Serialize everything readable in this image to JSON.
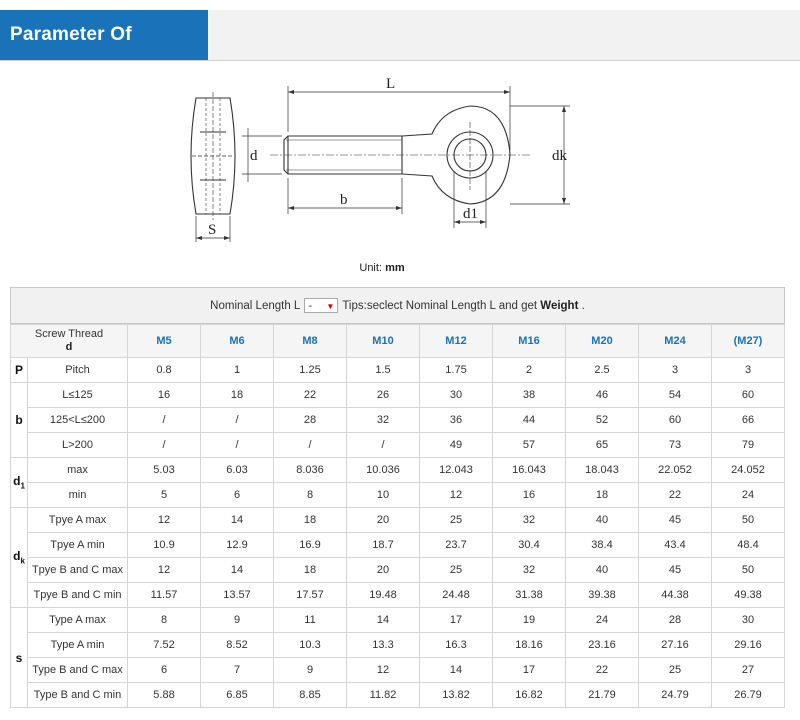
{
  "header": {
    "title": "Parameter Of Product"
  },
  "drawing": {
    "labels": {
      "L": "L",
      "d": "d",
      "dk": "dk",
      "b": "b",
      "d1": "d1",
      "S": "S"
    }
  },
  "unit": {
    "prefix": "Unit:",
    "value": "mm"
  },
  "selector": {
    "prefix": "Nominal Length L",
    "value": "-",
    "tips": "Tips:seclect Nominal Length L and get",
    "tips_bold": "Weight",
    "tips_end": "."
  },
  "table": {
    "header_label": "Screw Thread",
    "header_sub": "d",
    "columns": [
      "M5",
      "M6",
      "M8",
      "M10",
      "M12",
      "M16",
      "M20",
      "M24",
      "(M27)"
    ],
    "groups": [
      {
        "symbol": "P",
        "sub": "",
        "rows": [
          {
            "label": "Pitch",
            "values": [
              "0.8",
              "1",
              "1.25",
              "1.5",
              "1.75",
              "2",
              "2.5",
              "3",
              "3"
            ]
          }
        ]
      },
      {
        "symbol": "b",
        "sub": "",
        "rows": [
          {
            "label": "L≤125",
            "values": [
              "16",
              "18",
              "22",
              "26",
              "30",
              "38",
              "46",
              "54",
              "60"
            ]
          },
          {
            "label": "125<L≤200",
            "values": [
              "/",
              "/",
              "28",
              "32",
              "36",
              "44",
              "52",
              "60",
              "66"
            ]
          },
          {
            "label": "L>200",
            "values": [
              "/",
              "/",
              "/",
              "/",
              "49",
              "57",
              "65",
              "73",
              "79"
            ]
          }
        ]
      },
      {
        "symbol": "d",
        "sub": "1",
        "rows": [
          {
            "label": "max",
            "values": [
              "5.03",
              "6.03",
              "8.036",
              "10.036",
              "12.043",
              "16.043",
              "18.043",
              "22.052",
              "24.052"
            ]
          },
          {
            "label": "min",
            "values": [
              "5",
              "6",
              "8",
              "10",
              "12",
              "16",
              "18",
              "22",
              "24"
            ]
          }
        ]
      },
      {
        "symbol": "d",
        "sub": "k",
        "rows": [
          {
            "label": "Tpye A max",
            "values": [
              "12",
              "14",
              "18",
              "20",
              "25",
              "32",
              "40",
              "45",
              "50"
            ]
          },
          {
            "label": "Tpye A min",
            "values": [
              "10.9",
              "12.9",
              "16.9",
              "18.7",
              "23.7",
              "30.4",
              "38.4",
              "43.4",
              "48.4"
            ]
          },
          {
            "label": "Tpye B and C max",
            "values": [
              "12",
              "14",
              "18",
              "20",
              "25",
              "32",
              "40",
              "45",
              "50"
            ]
          },
          {
            "label": "Tpye B and C min",
            "values": [
              "11.57",
              "13.57",
              "17.57",
              "19.48",
              "24.48",
              "31.38",
              "39.38",
              "44.38",
              "49.38"
            ]
          }
        ]
      },
      {
        "symbol": "s",
        "sub": "",
        "rows": [
          {
            "label": "Type A max",
            "values": [
              "8",
              "9",
              "11",
              "14",
              "17",
              "19",
              "24",
              "28",
              "30"
            ]
          },
          {
            "label": "Type A min",
            "values": [
              "7.52",
              "8.52",
              "10.3",
              "13.3",
              "16.3",
              "18.16",
              "23.16",
              "27.16",
              "29.16"
            ]
          },
          {
            "label": "Type B and C max",
            "values": [
              "6",
              "7",
              "9",
              "12",
              "14",
              "17",
              "22",
              "25",
              "27"
            ]
          },
          {
            "label": "Type B and C min",
            "values": [
              "5.88",
              "6.85",
              "8.85",
              "11.82",
              "13.82",
              "16.82",
              "21.79",
              "24.79",
              "26.79"
            ]
          }
        ]
      }
    ]
  },
  "colors": {
    "accent": "#1a72b8",
    "header_bg": "#f2f2f2"
  }
}
